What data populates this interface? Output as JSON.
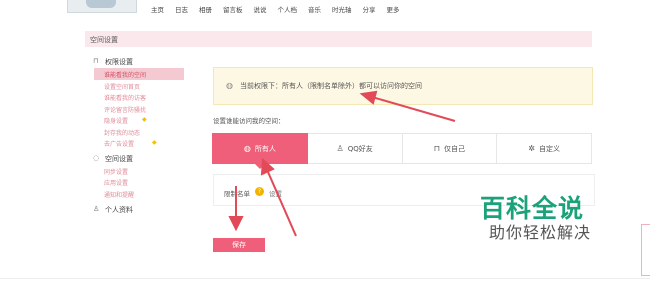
{
  "nav": {
    "items": [
      "主页",
      "日志",
      "相册",
      "留言板",
      "说说",
      "个人档",
      "音乐",
      "时光轴",
      "分享",
      "更多"
    ]
  },
  "section": {
    "title": "空间设置"
  },
  "sidebar": {
    "groups": [
      {
        "icon": "lock-icon",
        "label": "权限设置",
        "items": [
          {
            "label": "谁能看我的空间",
            "active": true
          },
          {
            "label": "设置空间首页"
          },
          {
            "label": "谁能看我的访客"
          },
          {
            "label": "评论留言防骚扰"
          },
          {
            "label": "隐身设置",
            "badge": "diamond"
          },
          {
            "label": "封存我的动态"
          },
          {
            "label": "去广告设置",
            "badge": "diamond"
          }
        ]
      },
      {
        "icon": "settings-icon",
        "label": "空间设置",
        "items": [
          {
            "label": "同步设置"
          },
          {
            "label": "应用设置"
          },
          {
            "label": "通知和提醒"
          }
        ]
      },
      {
        "icon": "person-icon",
        "label": "个人资料",
        "items": []
      }
    ]
  },
  "notice": {
    "text": "当前权限下：所有人（限制名单除外）都可以访问你的空间"
  },
  "visit": {
    "label": "设置谁能访问我的空间：",
    "options": [
      {
        "label": "所有人",
        "icon": "globe-icon",
        "glyph": "◍",
        "selected": true
      },
      {
        "label": "QQ好友",
        "icon": "friends-icon",
        "glyph": "♙"
      },
      {
        "label": "仅自己",
        "icon": "lock-icon",
        "glyph": "⊓"
      },
      {
        "label": "自定义",
        "icon": "gear-icon",
        "glyph": "✲"
      }
    ]
  },
  "blocklist": {
    "label": "限制名单",
    "suffix": "设置"
  },
  "actions": {
    "save_label": "保存"
  },
  "watermark": {
    "title": "百科全说",
    "subtitle": "助你轻松解决"
  },
  "colors": {
    "accent": "#ef5f79",
    "notice_bg": "#fdf8e4",
    "watermark": "#1ba27a",
    "arrow": "#e14a56"
  }
}
